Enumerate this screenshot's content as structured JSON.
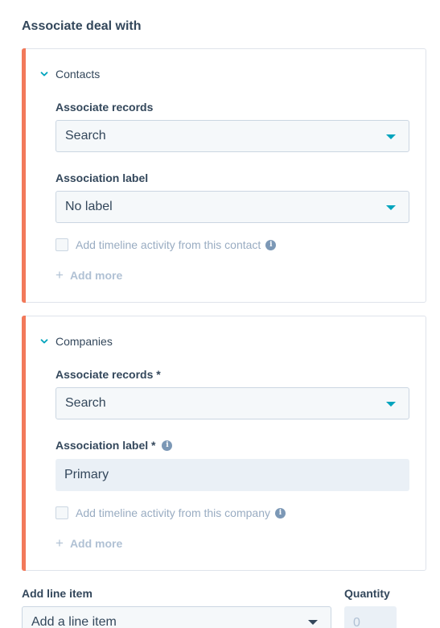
{
  "heading": "Associate deal with",
  "contacts": {
    "section_title": "Contacts",
    "associate_records_label": "Associate records",
    "associate_records_value": "Search",
    "association_label_label": "Association label",
    "association_label_value": "No label",
    "timeline_checkbox_label": "Add timeline activity from this contact",
    "add_more": "Add more"
  },
  "companies": {
    "section_title": "Companies",
    "associate_records_label": "Associate records *",
    "associate_records_value": "Search",
    "association_label_label": "Association label *",
    "association_label_value": "Primary",
    "timeline_checkbox_label": "Add timeline activity from this company",
    "add_more": "Add more"
  },
  "line_item": {
    "label": "Add line item",
    "placeholder": "Add a line item",
    "quantity_label": "Quantity",
    "quantity_value": "0"
  },
  "colors": {
    "accent": "#f2795a",
    "teal": "#00a4bd",
    "text": "#33475b",
    "muted": "#99acc2"
  },
  "icons": {
    "chevron": "chevron-down-icon",
    "caret": "caret-down-icon",
    "info": "info-icon",
    "plus": "plus-icon"
  }
}
